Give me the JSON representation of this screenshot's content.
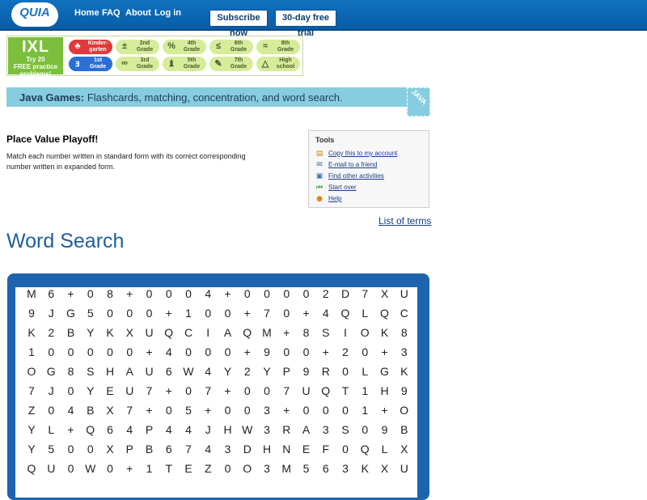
{
  "header": {
    "logo_text": "QUIA",
    "nav": [
      "Home",
      "FAQ",
      "About",
      "Log in"
    ],
    "subscribe_label": "Subscribe now",
    "trial_label": "30-day free trial"
  },
  "ixl": {
    "logo": "IXL",
    "promo": [
      "Try 20",
      "FREE practice",
      "problems!"
    ],
    "grades": [
      {
        "line1": "Kinder-",
        "line2": "garten",
        "icon": "♣"
      },
      {
        "line1": "1st",
        "line2": "Grade",
        "icon": "ⱻ"
      },
      {
        "line1": "2nd",
        "line2": "Grade",
        "icon": "±"
      },
      {
        "line1": "3rd",
        "line2": "Grade",
        "icon": "∞"
      },
      {
        "line1": "4th",
        "line2": "Grade",
        "icon": "%"
      },
      {
        "line1": "5th",
        "line2": "Grade",
        "icon": "♝"
      },
      {
        "line1": "6th",
        "line2": "Grade",
        "icon": "≤"
      },
      {
        "line1": "7th",
        "line2": "Grade",
        "icon": "✎"
      },
      {
        "line1": "8th",
        "line2": "Grade",
        "icon": "≈"
      },
      {
        "line1": "High",
        "line2": "school",
        "icon": "△"
      }
    ]
  },
  "java_bar": {
    "label": "Java Games:",
    "text": " Flashcards, matching, concentration, and word search.",
    "icon_text": "JAVA"
  },
  "activity": {
    "title": "Place Value Playoff!",
    "description": "Match each number written in standard form with its correct corresponding number written in expanded form."
  },
  "tools": {
    "heading": "Tools",
    "items": [
      {
        "label": "Copy this to my account",
        "icon": "copy-icon"
      },
      {
        "label": "E-mail to a friend",
        "icon": "email-icon"
      },
      {
        "label": "Find other activities",
        "icon": "search-icon"
      },
      {
        "label": "Start over",
        "icon": "rewind-icon"
      },
      {
        "label": "Help",
        "icon": "help-icon"
      }
    ]
  },
  "list_of_terms": "List of terms",
  "heading": "Word Search",
  "grid": [
    "M6+08+0004+00002D7XU",
    "9JG5000+100+70+4QLQC",
    "K2BYKXUQCIAQM+8SIOK8",
    "100000+4000+900+20+3",
    "OG8SHAU6W4Y2YP9R0LGK",
    "7J0YEU7+07+007UQT1H9",
    "Z04BX7+05+003+0001+O",
    "YL+Q64P44JHW3RA3S09B",
    "Y500XPB6743DHNEF0QLX",
    "QU0W0+1TEZ0O3M563KXU"
  ]
}
